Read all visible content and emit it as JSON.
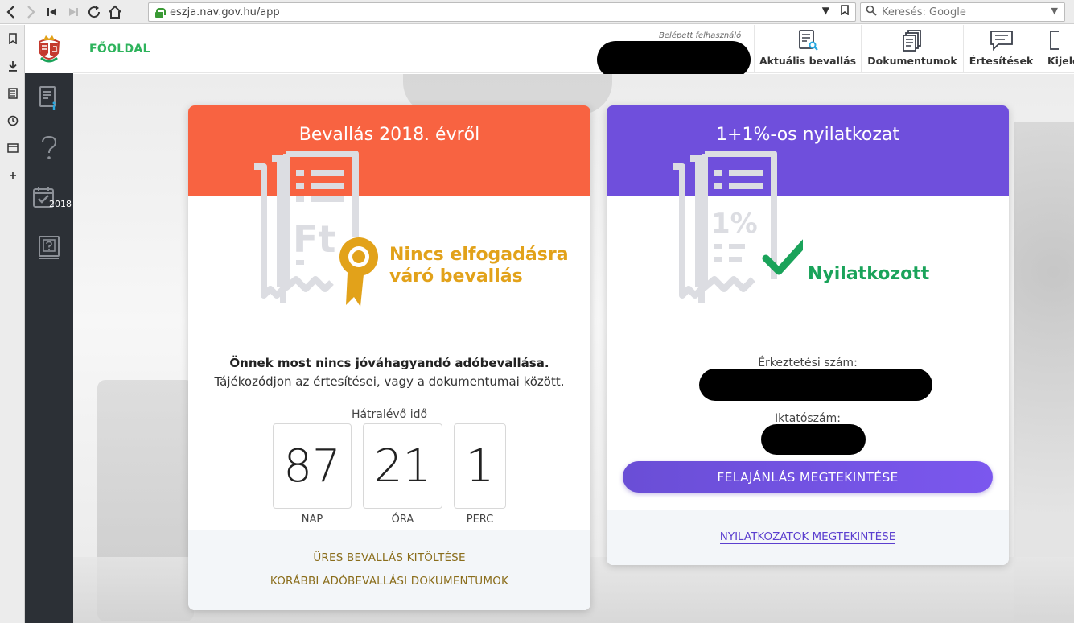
{
  "browser": {
    "url": "eszja.nav.gov.hu/app",
    "search_placeholder": "Keresés: Google"
  },
  "header": {
    "home_label": "FŐOLDAL",
    "user_label": "Belépett felhasználó",
    "nav_items": [
      {
        "label": "Aktuális bevallás",
        "icon": "document-search-icon"
      },
      {
        "label": "Dokumentumok",
        "icon": "documents-stack-icon"
      },
      {
        "label": "Értesítések",
        "icon": "message-icon"
      },
      {
        "label": "Kijele",
        "icon": "exit-icon"
      }
    ]
  },
  "sidebar": {
    "items": [
      {
        "icon": "document-info-icon"
      },
      {
        "icon": "help-question-icon"
      },
      {
        "icon": "calendar-check-icon",
        "year": "2018"
      },
      {
        "icon": "help-book-icon"
      }
    ]
  },
  "tax_card": {
    "title": "Bevallás 2018. évről",
    "status": [
      "Nincs elfogadásra",
      "váró bevallás"
    ],
    "message_bold": "Önnek most nincs jóváhagyandó adóbevallása.",
    "message": "Tájékozódjon az értesítései, vagy a dokumentumai között.",
    "remaining_label": "Hátralévő idő",
    "countdown": [
      {
        "value": "87",
        "unit": "NAP"
      },
      {
        "value": "21",
        "unit": "ÓRA"
      },
      {
        "value": "1",
        "unit": "PERC"
      }
    ],
    "links": [
      "ÜRES BEVALLÁS KITÖLTÉSE",
      "KORÁBBI ADÓBEVALLÁSI DOKUMENTUMOK"
    ],
    "colors": {
      "header": "#f86341",
      "status": "#e2a21a"
    }
  },
  "declaration_card": {
    "title": "1+1%-os nyilatkozat",
    "status": "Nyilatkozott",
    "arrival_label": "Érkeztetési szám:",
    "filing_label": "Iktatószám:",
    "button_label": "FELAJÁNLÁS MEGTEKINTÉSE",
    "footer_link": "NYILATKOZATOK MEGTEKINTÉSE",
    "colors": {
      "header": "#6f4fdc",
      "status": "#1aa35a"
    }
  }
}
